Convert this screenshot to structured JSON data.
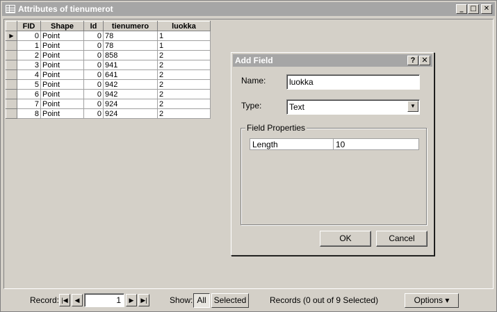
{
  "window": {
    "title": "Attributes of tienumerot",
    "minimize": "_",
    "maximize": "□",
    "close": "✕"
  },
  "table": {
    "columns": [
      "FID",
      "Shape",
      "Id",
      "tienumero",
      "luokka"
    ],
    "rows": [
      [
        "0",
        "Point",
        "0",
        "78",
        "1"
      ],
      [
        "1",
        "Point",
        "0",
        "78",
        "1"
      ],
      [
        "2",
        "Point",
        "0",
        "858",
        "2"
      ],
      [
        "3",
        "Point",
        "0",
        "941",
        "2"
      ],
      [
        "4",
        "Point",
        "0",
        "641",
        "2"
      ],
      [
        "5",
        "Point",
        "0",
        "942",
        "2"
      ],
      [
        "6",
        "Point",
        "0",
        "942",
        "2"
      ],
      [
        "7",
        "Point",
        "0",
        "924",
        "2"
      ],
      [
        "8",
        "Point",
        "0",
        "924",
        "2"
      ]
    ],
    "current_row_marker": "▶"
  },
  "dialog": {
    "title": "Add Field",
    "help": "?",
    "close": "✕",
    "name_label": "Name:",
    "name_value": "luokka",
    "type_label": "Type:",
    "type_value": "Text",
    "group_label": "Field Properties",
    "props": [
      [
        "Length",
        "10"
      ]
    ],
    "ok_label": "OK",
    "cancel_label": "Cancel"
  },
  "status": {
    "record_label": "Record:",
    "record_value": "1",
    "show_label": "Show:",
    "all_label": "All",
    "selected_label": "Selected",
    "records_text": "Records (0 out of 9 Selected)",
    "options_label": "Options",
    "options_arrow": "▾",
    "first": "|◀",
    "prev": "◀",
    "next": "▶",
    "last": "▶|"
  }
}
